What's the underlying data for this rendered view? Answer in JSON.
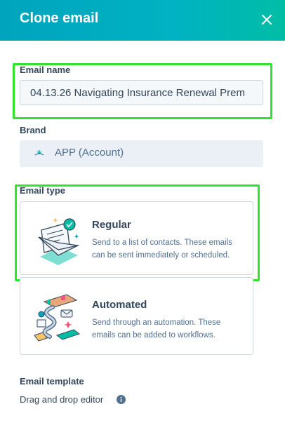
{
  "dialog": {
    "title": "Clone email",
    "close_icon": "close-icon"
  },
  "email_name": {
    "label": "Email name",
    "value": "04.13.26 Navigating Insurance Renewal Prem"
  },
  "brand": {
    "label": "Brand",
    "value": "APP (Account)",
    "logo_icon": "brand-logo-icon"
  },
  "email_type": {
    "label": "Email type",
    "options": [
      {
        "title": "Regular",
        "description": "Send to a list of contacts. These emails can be sent immediately or scheduled.",
        "icon": "regular-email-illustration"
      },
      {
        "title": "Automated",
        "description": "Send through an automation. These emails can be added to workflows.",
        "icon": "automated-email-illustration"
      }
    ]
  },
  "email_template": {
    "label": "Email template",
    "value": "Drag and drop editor",
    "info_icon": "info-icon"
  },
  "colors": {
    "header_start": "#00a4bd",
    "header_end": "#00bda5",
    "highlight": "#2ee52e",
    "text_primary": "#33475b",
    "text_secondary": "#516f90"
  }
}
